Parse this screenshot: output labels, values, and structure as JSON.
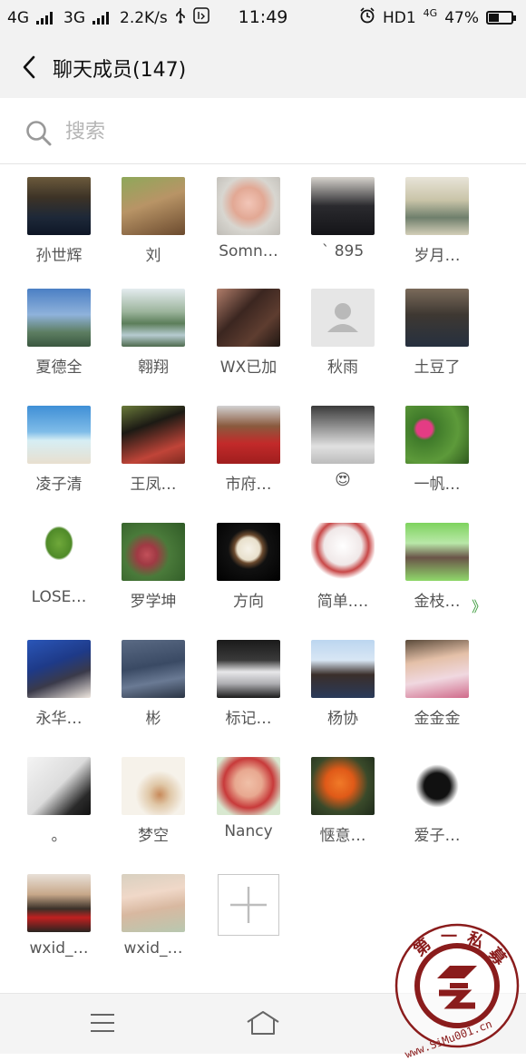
{
  "status_bar": {
    "network1": "4G",
    "network2": "3G",
    "speed": "2.2K/s",
    "time": "11:49",
    "hd": "HD1",
    "net3": "4G",
    "battery_text": "47%",
    "battery_level": 0.47
  },
  "header": {
    "title": "聊天成员(147)"
  },
  "search": {
    "placeholder": "搜索"
  },
  "members": [
    {
      "name": "孙世辉",
      "avatar": "photo-man-dark"
    },
    {
      "name": "刘",
      "avatar": "photo-child-outdoor"
    },
    {
      "name": "Somn…",
      "avatar": "photo-pig-toy"
    },
    {
      "name": "ˋ 895",
      "avatar": "photo-person-sitting"
    },
    {
      "name": "岁月…",
      "avatar": "photo-living-room"
    },
    {
      "name": "夏德全",
      "avatar": "photo-city-skyline"
    },
    {
      "name": "翱翔",
      "avatar": "photo-lake-mountain"
    },
    {
      "name": "WX已加",
      "avatar": "photo-woman-portrait"
    },
    {
      "name": "秋雨",
      "avatar": "default-avatar"
    },
    {
      "name": "土豆了",
      "avatar": "photo-store-man"
    },
    {
      "name": "凌子清",
      "avatar": "photo-beach"
    },
    {
      "name": "王凤…",
      "avatar": "photo-woman-red"
    },
    {
      "name": "市府…",
      "avatar": "photo-basketball"
    },
    {
      "name": "😍",
      "avatar": "photo-man-hat"
    },
    {
      "name": "一帆…",
      "avatar": "photo-pink-flowers"
    },
    {
      "name": "LOSE…",
      "avatar": "photo-banana-logo"
    },
    {
      "name": "罗学坤",
      "avatar": "photo-lychee"
    },
    {
      "name": "方向",
      "avatar": "photo-watch"
    },
    {
      "name": "简单.…",
      "avatar": "photo-cartoon-girl"
    },
    {
      "name": "金枝…",
      "avatar": "photo-family-green"
    },
    {
      "name": "永华…",
      "avatar": "photo-couple-blue"
    },
    {
      "name": "彬",
      "avatar": "photo-denim"
    },
    {
      "name": "标记…",
      "avatar": "photo-white-car"
    },
    {
      "name": "杨协",
      "avatar": "photo-man-sky"
    },
    {
      "name": "金金金",
      "avatar": "photo-little-girl"
    },
    {
      "name": "。",
      "avatar": "photo-desk-pen"
    },
    {
      "name": "梦空",
      "avatar": "photo-ink-drawing"
    },
    {
      "name": "Nancy",
      "avatar": "photo-baby-glasses"
    },
    {
      "name": "惬意…",
      "avatar": "photo-orange-flower"
    },
    {
      "name": "爱子…",
      "avatar": "photo-calligraphy"
    },
    {
      "name": "wxid_…",
      "avatar": "photo-man-suit"
    },
    {
      "name": "wxid_…",
      "avatar": "photo-baby-lying"
    }
  ],
  "partial_glyph": "》",
  "watermark": {
    "chars": [
      "第",
      "一",
      "私",
      "募"
    ],
    "url": "www.SiMu001.cn"
  },
  "icons": {
    "back": "chevron-left-icon",
    "search": "search-icon",
    "add": "plus-icon",
    "menu": "menu-icon",
    "home": "home-icon"
  }
}
